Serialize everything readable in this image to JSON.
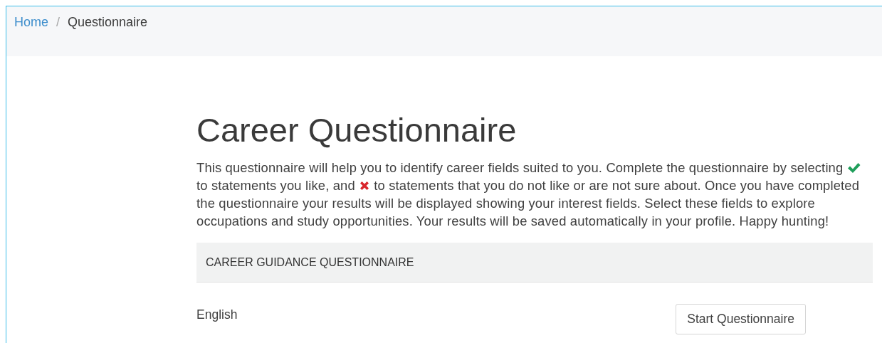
{
  "breadcrumb": [
    {
      "label": "Home",
      "link": true
    },
    {
      "label": "Questionnaire",
      "link": false
    }
  ],
  "breadcrumb_separator": "/",
  "title": "Career Questionnaire",
  "intro": [
    {
      "kind": "text",
      "text": "This questionnaire will help you to identify career fields suited to you. Complete the questionnaire by selecting "
    },
    {
      "kind": "check"
    },
    {
      "kind": "text",
      "text": " to statements you like, and "
    },
    {
      "kind": "cross"
    },
    {
      "kind": "text",
      "text": " to statements that you do not like or are not sure about. Once you have completed the questionnaire your results will be displayed showing your interest fields. Select these fields to explore occupations and study opportunities. Your results will be saved automatically in your profile. Happy hunting!"
    }
  ],
  "panel": {
    "heading": "CAREER GUIDANCE QUESTIONNAIRE",
    "rows": [
      {
        "language": "English",
        "button": "Start Questionnaire"
      }
    ]
  }
}
